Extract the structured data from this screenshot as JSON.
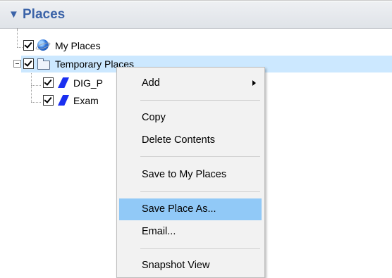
{
  "panel": {
    "header_arrow": "▼",
    "title": "Places"
  },
  "tree": {
    "items": [
      {
        "label": "My Places"
      },
      {
        "label": "Temporary Places"
      },
      {
        "label": "DIG_P"
      },
      {
        "label": "Exam"
      }
    ]
  },
  "context_menu": {
    "items": [
      {
        "label": "Add"
      },
      {
        "label": "Copy"
      },
      {
        "label": "Delete Contents"
      },
      {
        "label": "Save to My Places"
      },
      {
        "label": "Save Place As..."
      },
      {
        "label": "Email..."
      },
      {
        "label": "Snapshot View"
      }
    ],
    "highlighted": "Save Place As..."
  },
  "colors": {
    "header_text": "#3b63a8",
    "selection": "#cce8ff",
    "menu_highlight": "#91c9f7",
    "polygon_icon": "#1a2ff0"
  }
}
